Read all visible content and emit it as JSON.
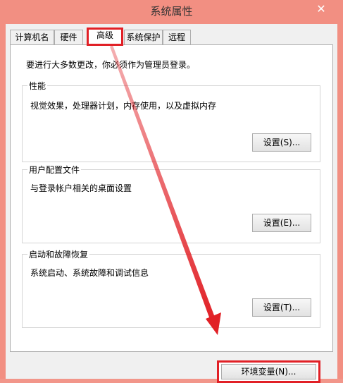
{
  "window": {
    "title": "系统属性",
    "close_icon": "close-icon"
  },
  "tabs": [
    {
      "label": "计算机名",
      "selected": false
    },
    {
      "label": "硬件",
      "selected": false
    },
    {
      "label": "高级",
      "selected": true
    },
    {
      "label": "系统保护",
      "selected": false
    },
    {
      "label": "远程",
      "selected": false
    }
  ],
  "advanced": {
    "admin_note": "要进行大多数更改，你必须作为管理员登录。",
    "performance": {
      "title": "性能",
      "description": "视觉效果，处理器计划，内存使用，以及虚拟内存",
      "button_label": "设置(S)..."
    },
    "profiles": {
      "title": "用户配置文件",
      "description": "与登录帐户相关的桌面设置",
      "button_label": "设置(E)..."
    },
    "startup": {
      "title": "启动和故障恢复",
      "description": "系统启动、系统故障和调试信息",
      "button_label": "设置(T)..."
    },
    "env_button_label": "环境变量(N)..."
  },
  "annotation": {
    "highlight_color": "#e12026"
  }
}
